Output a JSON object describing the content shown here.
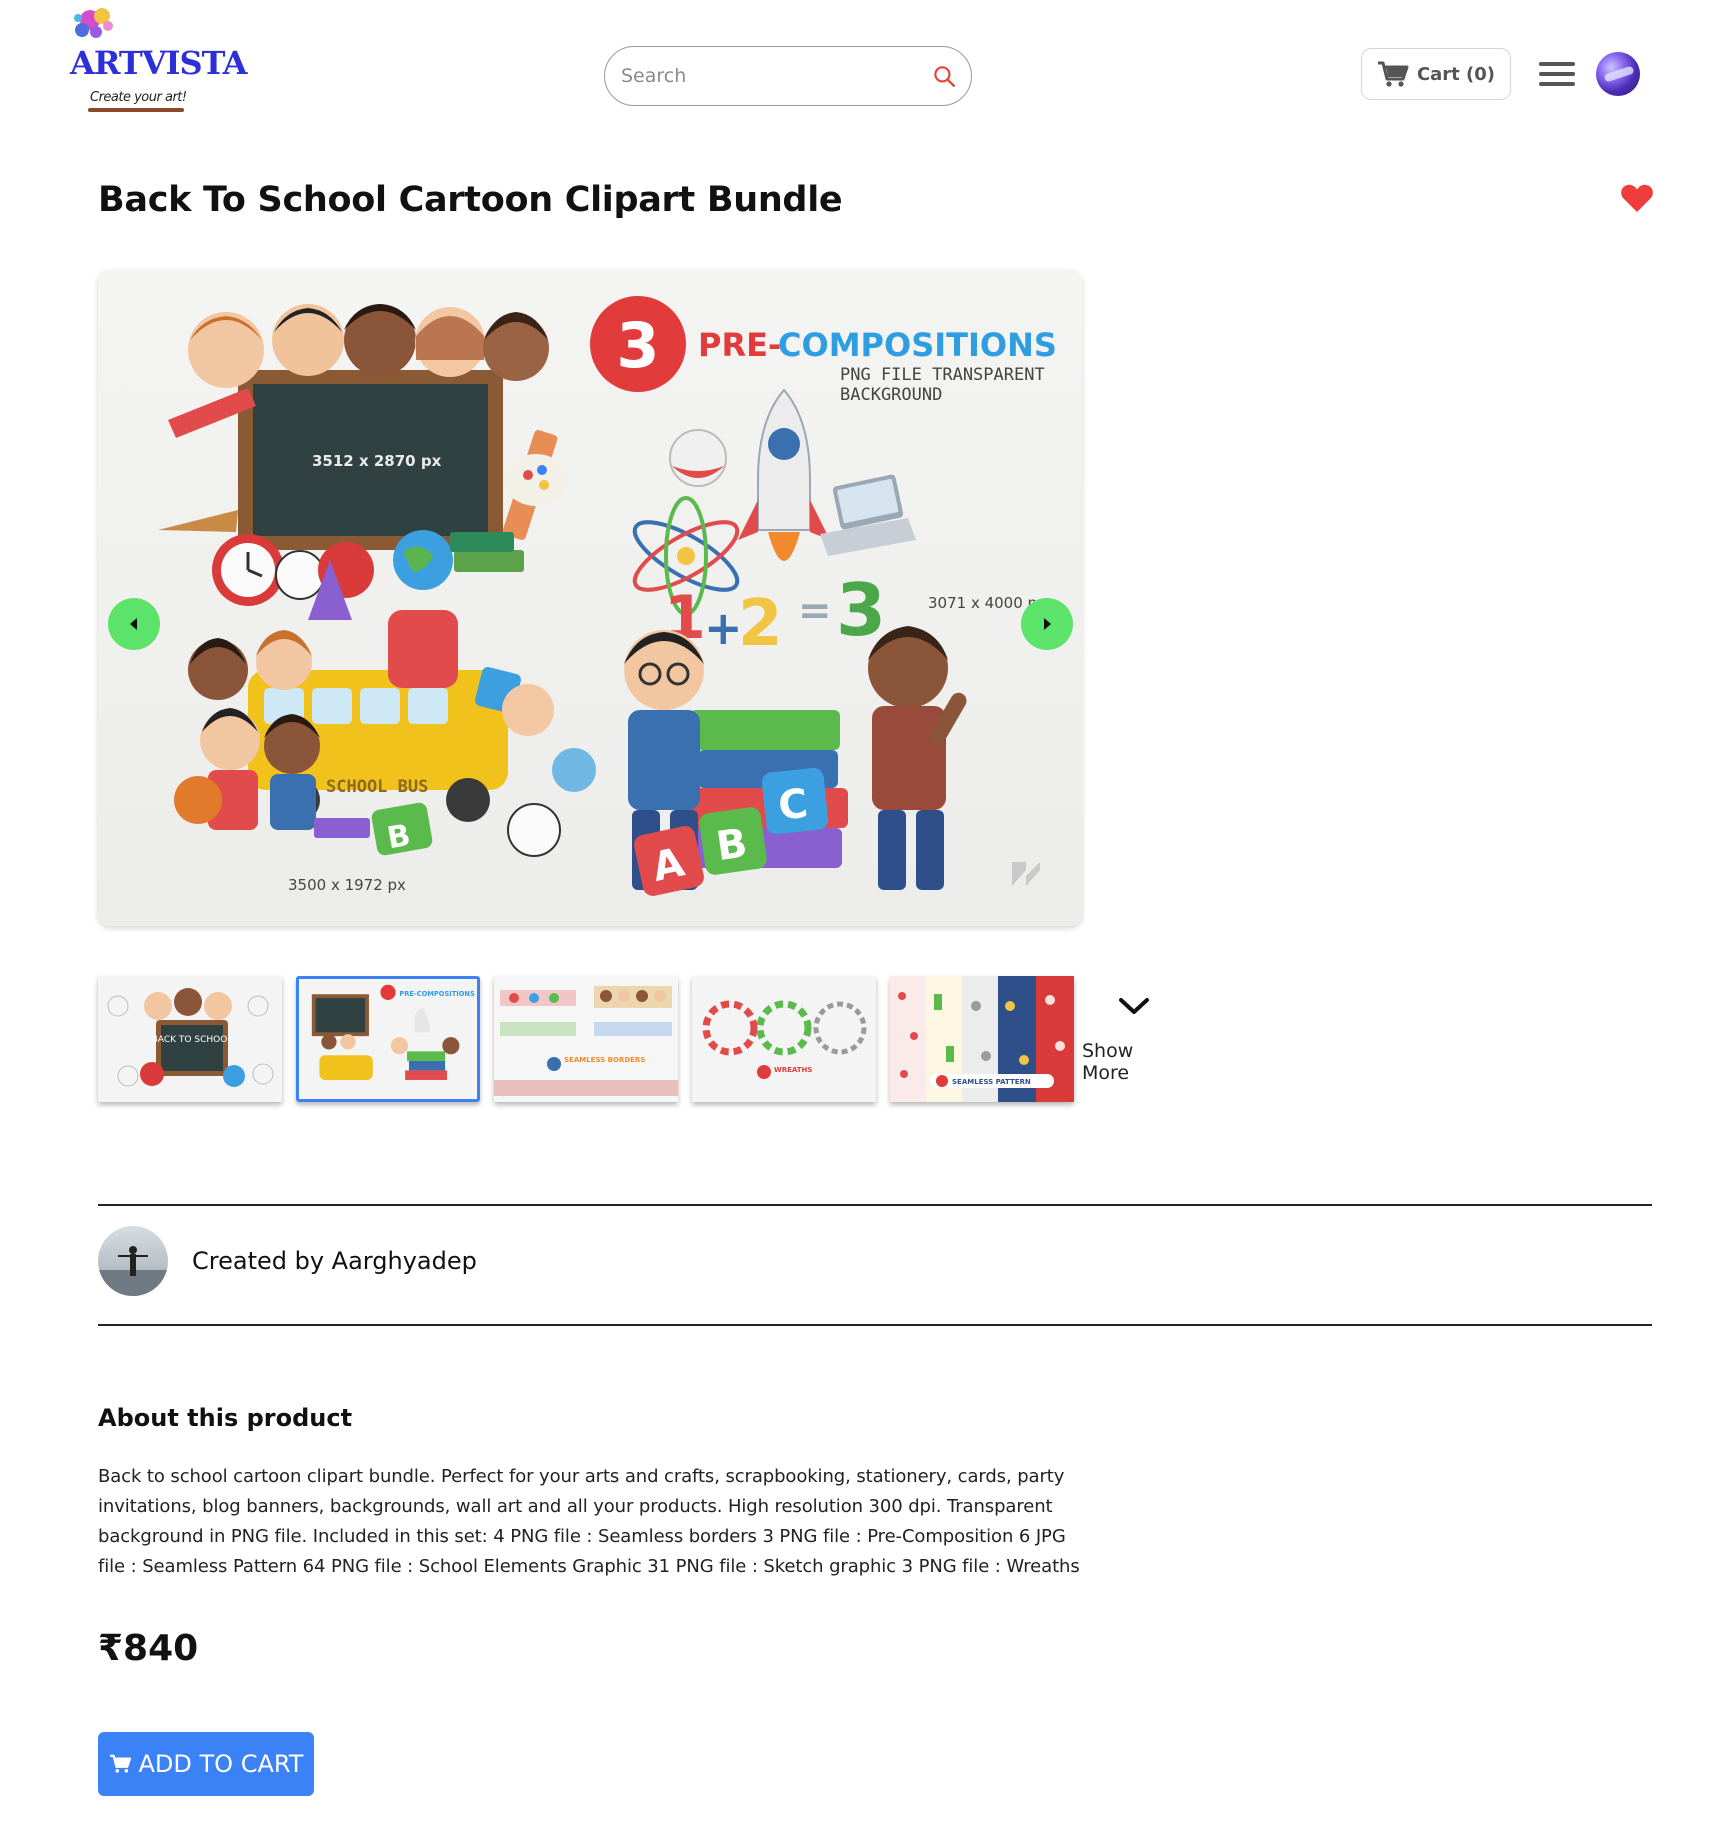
{
  "brand": {
    "name": "ARTVISTA",
    "tagline": "Create your art!"
  },
  "search": {
    "placeholder": "Search"
  },
  "cart": {
    "label": "Cart (0)"
  },
  "icons": {
    "search": "search-icon",
    "cart": "cart-icon",
    "menu": "hamburger-menu-icon",
    "favorite": "heart-icon",
    "prev": "chevron-left-icon",
    "next": "chevron-right-icon",
    "show_more": "chevron-down-icon"
  },
  "colors": {
    "accent": "#3b82f6",
    "heart": "#ef3d3d",
    "carousel_arrow": "#5be36a",
    "brand": "#2f2fd8"
  },
  "product": {
    "title": "Back To School Cartoon Clipart Bundle",
    "favorited": true,
    "main_image": {
      "headline_number": "3",
      "headline_word_1": "PRE-",
      "headline_word_2": "COMPOSITIONS",
      "subline_1": "PNG FILE TRANSPARENT",
      "subline_2": "BACKGROUND",
      "label_board": "3512 x 2870 px",
      "label_right": "3071 x 4000 px",
      "label_bottom": "3500 x 1972 px",
      "bus_text": "SCHOOL BUS"
    },
    "thumbnails": [
      {
        "caption": "BACK TO SCHOOL",
        "active": false
      },
      {
        "caption": "PRE-COMPOSITIONS",
        "active": true
      },
      {
        "caption": "SEAMLESS BORDERS",
        "active": false
      },
      {
        "caption": "WREATHS",
        "active": false
      },
      {
        "caption": "SEAMLESS PATTERN",
        "active": false
      }
    ],
    "show_more_label": "Show More",
    "creator": "Created by Aarghyadep",
    "about_heading": "About this product",
    "description": "Back to school cartoon clipart bundle. Perfect for your arts and crafts, scrapbooking, stationery, cards, party invitations, blog banners, backgrounds, wall art and all your products. High resolution 300 dpi. Transparent background in PNG file. Included in this set: 4 PNG file : Seamless borders 3 PNG file : Pre-Composition 6 JPG file : Seamless Pattern 64 PNG file : School Elements Graphic 31 PNG file : Sketch graphic 3 PNG file : Wreaths",
    "price": "₹840",
    "add_to_cart_label": "ADD TO CART"
  }
}
